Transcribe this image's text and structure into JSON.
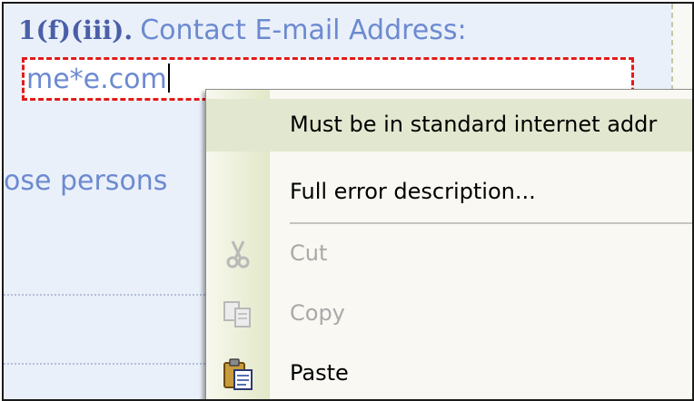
{
  "form": {
    "field_number": "1(f)(iii).",
    "field_label": "Contact E-mail Address:",
    "email_value": "me*e.com",
    "partial_text": "ose persons"
  },
  "context_menu": {
    "items": [
      {
        "label": "Must be in standard internet addr",
        "highlighted": true
      },
      {
        "label": "Full error description...",
        "enabled": true
      },
      {
        "label": "Cut",
        "enabled": false,
        "icon": "scissors-icon"
      },
      {
        "label": "Copy",
        "enabled": false,
        "icon": "copy-icon"
      },
      {
        "label": "Paste",
        "enabled": true,
        "icon": "clipboard-icon"
      }
    ]
  },
  "colors": {
    "field_text": "#6c8ad0",
    "error_border": "#e11b1b",
    "highlight_bg": "#e2e7cf"
  }
}
